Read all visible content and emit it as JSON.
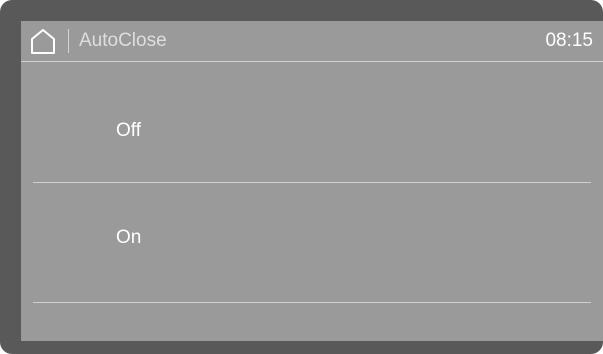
{
  "header": {
    "home_icon": "home-icon",
    "title": "AutoClose",
    "time": "08:15"
  },
  "options": [
    {
      "label": "Off"
    },
    {
      "label": "On"
    }
  ],
  "colors": {
    "bezel": "#595959",
    "screen": "#9a9a9a",
    "divider": "#d0d0d0",
    "text": "#ffffff"
  }
}
